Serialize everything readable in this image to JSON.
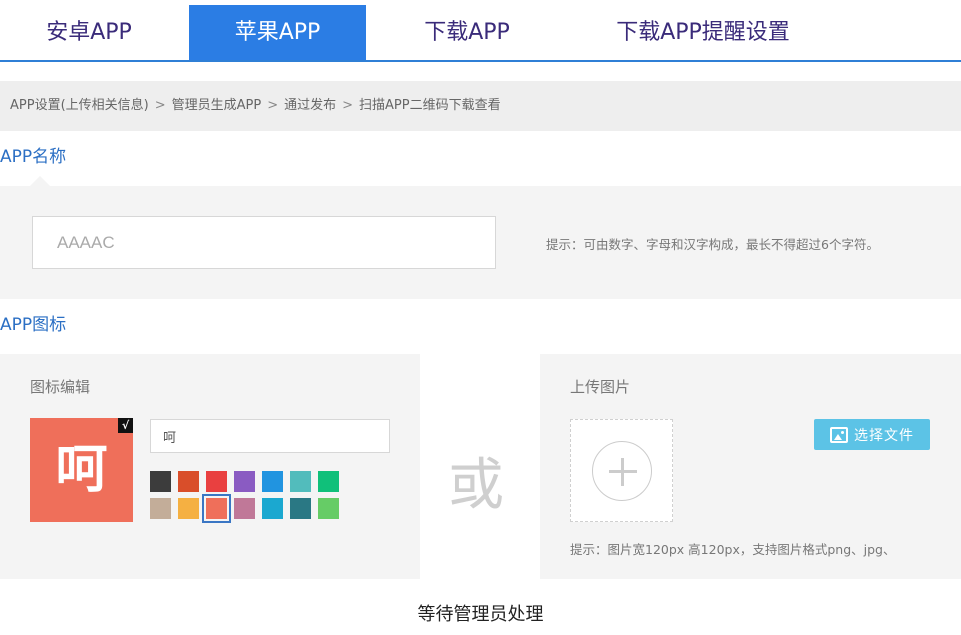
{
  "tabs": [
    {
      "label": "安卓APP",
      "active": false
    },
    {
      "label": "苹果APP",
      "active": true
    },
    {
      "label": "下载APP",
      "active": false
    },
    {
      "label": "下载APP提醒设置",
      "active": false
    }
  ],
  "breadcrumb": {
    "steps": [
      "APP设置(上传相关信息)",
      "管理员生成APP",
      "通过发布",
      "扫描APP二维码下载查看"
    ],
    "separator": ">"
  },
  "app_name": {
    "section_title": "APP名称",
    "input_value": "AAAAC",
    "hint": "提示：可由数字、字母和汉字构成，最长不得超过6个字符。"
  },
  "app_icon": {
    "section_title": "APP图标",
    "edit": {
      "label": "图标编辑",
      "preview_char": "呵",
      "preview_color": "#ef6f5a",
      "check_mark": "√",
      "char_input_value": "呵",
      "swatches": [
        "#3c3c3c",
        "#d94e2a",
        "#e94040",
        "#8a5bc2",
        "#2194e0",
        "#52bcbc",
        "#10c07a",
        "#c3ad99",
        "#f5b042",
        "#ef6f5a",
        "#c07898",
        "#1ba8d0",
        "#2a7884",
        "#66cc66"
      ],
      "selected_swatch": 9
    },
    "or_text": "或",
    "upload": {
      "label": "上传图片",
      "button_label": "选择文件",
      "button_icon": "image-icon",
      "hint": "提示：图片宽120px 高120px，支持图片格式png、jpg、"
    }
  },
  "status": "等待管理员处理",
  "colors": {
    "accent": "#2b7de4",
    "panel_bg": "#f4f4f4",
    "upload_button": "#5cc3e6"
  }
}
